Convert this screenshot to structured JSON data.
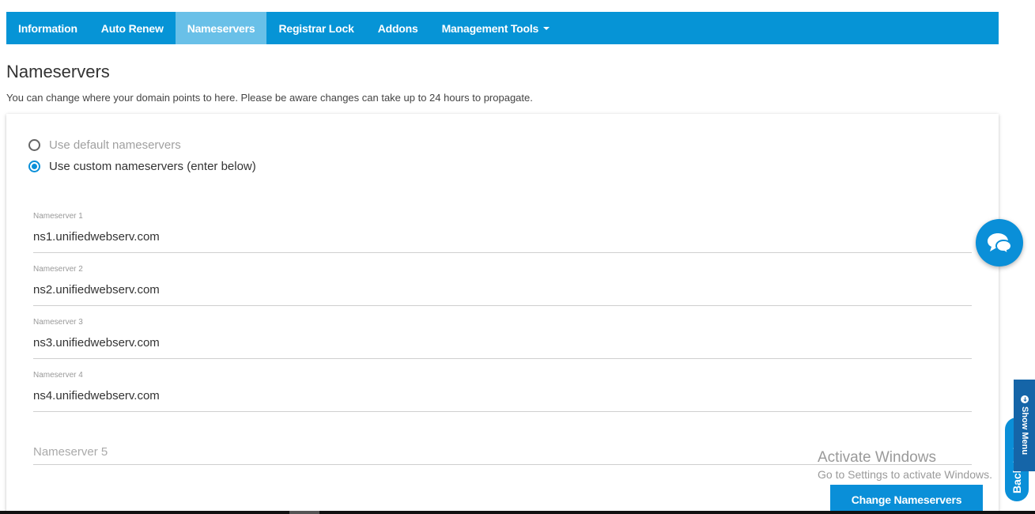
{
  "tabs": [
    {
      "label": "Information"
    },
    {
      "label": "Auto Renew"
    },
    {
      "label": "Nameservers"
    },
    {
      "label": "Registrar Lock"
    },
    {
      "label": "Addons"
    },
    {
      "label": "Management Tools"
    }
  ],
  "active_tab": "Nameservers",
  "page": {
    "title": "Nameservers",
    "description": "You can change where your domain points to here. Please be aware changes can take up to 24 hours to propagate."
  },
  "options": {
    "default_label": "Use default nameservers",
    "custom_label": "Use custom nameservers (enter below)",
    "selected": "custom"
  },
  "nameservers": [
    {
      "label": "Nameserver 1",
      "value": "ns1.unifiedwebserv.com"
    },
    {
      "label": "Nameserver 2",
      "value": "ns2.unifiedwebserv.com"
    },
    {
      "label": "Nameserver 3",
      "value": "ns3.unifiedwebserv.com"
    },
    {
      "label": "Nameserver 4",
      "value": "ns4.unifiedwebserv.com"
    },
    {
      "label": "Nameserver 5",
      "value": "",
      "placeholder": "Nameserver 5"
    }
  ],
  "submit_label": "Change Nameservers",
  "watermark": {
    "line1": "Activate Windows",
    "line2": "Go to Settings to activate Windows."
  },
  "back_to_top_label": "Back to top",
  "show_menu_label": "Show Menu",
  "colors": {
    "primary": "#0694d6",
    "active_tab": "#69c0e8",
    "show_menu": "#1565a8"
  },
  "icons": {
    "chat": "chat-bubbles-icon",
    "dropdown": "caret-down-icon",
    "show_menu": "arrow-circle-icon"
  }
}
